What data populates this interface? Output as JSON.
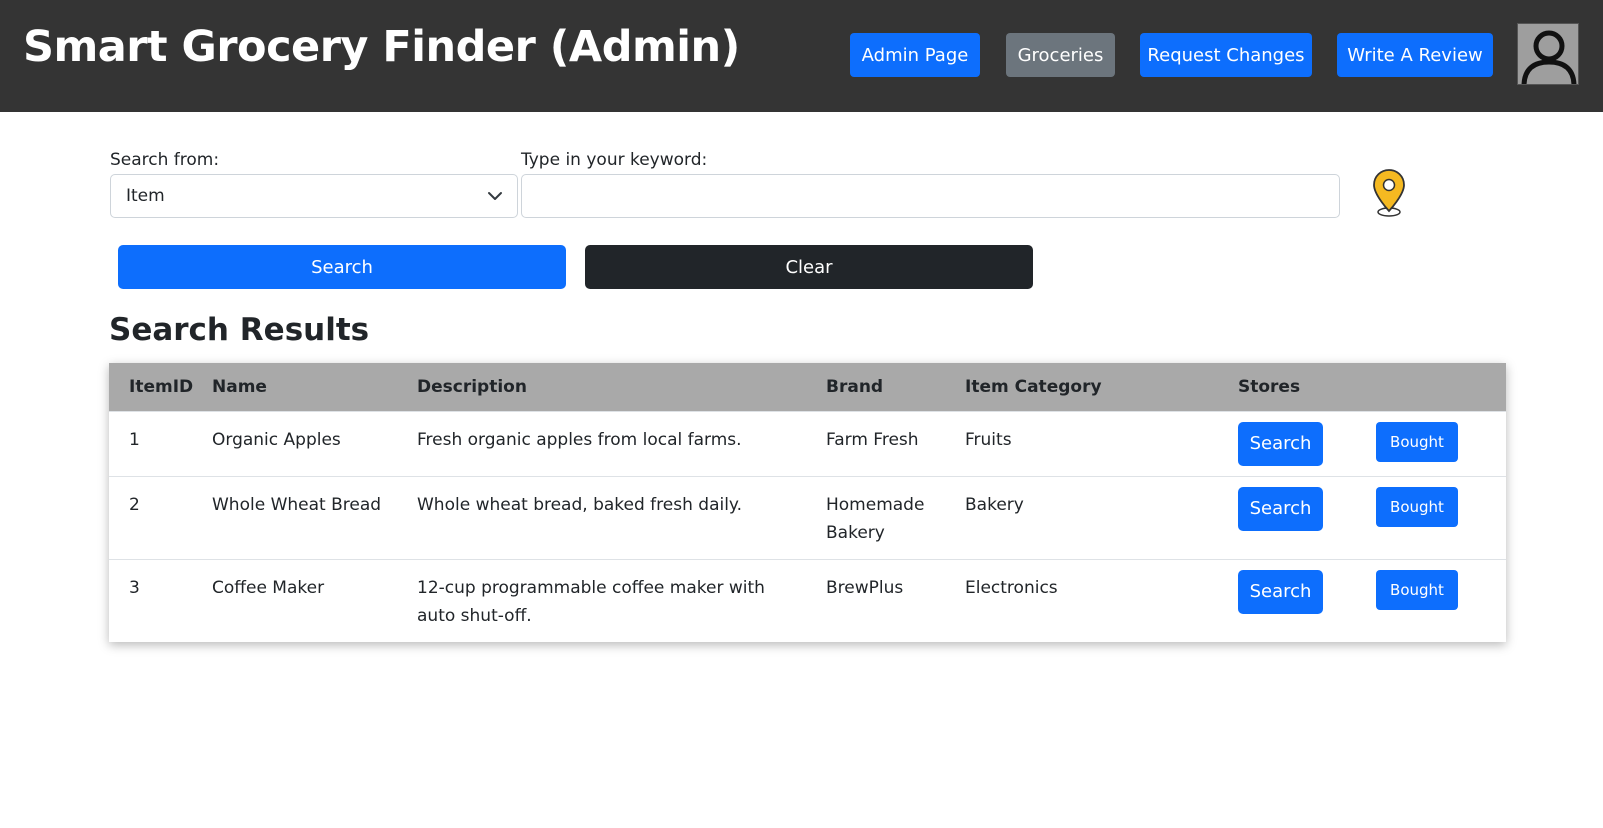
{
  "header": {
    "title": "Smart Grocery Finder (Admin)",
    "nav": [
      "Admin Page",
      "Groceries",
      "Request Changes",
      "Write A Review"
    ],
    "avatar_icon": "user-avatar-icon"
  },
  "search": {
    "from_label": "Search from:",
    "from_value": "Item",
    "keyword_label": "Type in your keyword:",
    "keyword_value": "",
    "search_label": "Search",
    "clear_label": "Clear",
    "location_icon": "location-pin-icon"
  },
  "results": {
    "title": "Search Results",
    "columns": [
      "ItemID",
      "Name",
      "Description",
      "Brand",
      "Item Category",
      "Stores"
    ],
    "rows": [
      {
        "id": "1",
        "name": "Organic Apples",
        "description": "Fresh organic apples from local farms.",
        "brand": "Farm Fresh",
        "category": "Fruits",
        "search_label": "Search",
        "bought_label": "Bought"
      },
      {
        "id": "2",
        "name": "Whole Wheat Bread",
        "description": "Whole wheat bread, baked fresh daily.",
        "brand": "Homemade Bakery",
        "category": "Bakery",
        "search_label": "Search",
        "bought_label": "Bought"
      },
      {
        "id": "3",
        "name": "Coffee Maker",
        "description": "12-cup programmable coffee maker with auto shut-off.",
        "brand": "BrewPlus",
        "category": "Electronics",
        "search_label": "Search",
        "bought_label": "Bought"
      }
    ]
  },
  "colors": {
    "header_bg": "#343434",
    "primary": "#0d6efd",
    "secondary": "#6c757d",
    "dark": "#212529",
    "table_head": "#a9a9a9",
    "pin": "#f5b921"
  }
}
